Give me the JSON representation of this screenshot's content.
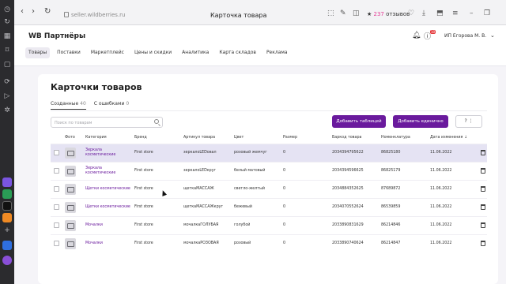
{
  "browser": {
    "url": "seller.wildberries.ru",
    "tab_title": "Карточка товара",
    "reviews_count": "237",
    "reviews_label": "отзывов"
  },
  "header": {
    "logo": "WB Партнёры",
    "notification_count": "10",
    "user_name": "ИП Егорова М. В."
  },
  "menu": [
    "Товары",
    "Поставки",
    "Маркетплейс",
    "Цены и скидки",
    "Аналитика",
    "Карта складов",
    "Реклама"
  ],
  "main": {
    "title": "Карточки товаров",
    "tabs": [
      {
        "label": "Созданные",
        "count": "40"
      },
      {
        "label": "С ошибками",
        "count": "0"
      }
    ],
    "search_placeholder": "Поиск по товарам",
    "btn_add_table": "Добавить таблицей",
    "btn_add_single": "Добавить единично"
  },
  "table": {
    "columns": [
      "",
      "Фото",
      "Категория",
      "Бренд",
      "Артикул товара",
      "Цвет",
      "Размер",
      "Баркод товара",
      "Номенклатура",
      "Дата изменения",
      ""
    ],
    "rows": [
      {
        "category": "Зеркала косметические",
        "brand": "First store",
        "article": "зеркалоLEDовал",
        "color": "розовый жемчуг",
        "size": "0",
        "barcode": "2034394795622",
        "nomenclature": "86825180",
        "date": "11.06.2022"
      },
      {
        "category": "Зеркала косметические",
        "brand": "First store",
        "article": "зеркалоLEDкруг",
        "color": "белый матовый",
        "size": "0",
        "barcode": "2034394596625",
        "nomenclature": "86825179",
        "date": "11.06.2022"
      },
      {
        "category": "Щетки косметические",
        "brand": "First store",
        "article": "щеткаМАССАЖ",
        "color": "светло-желтый",
        "size": "0",
        "barcode": "2034884352625",
        "nomenclature": "87689872",
        "date": "11.06.2022"
      },
      {
        "category": "Щетки косметические",
        "brand": "First store",
        "article": "щеткаМАССАЖкруг",
        "color": "бежевый",
        "size": "0",
        "barcode": "2034070552624",
        "nomenclature": "86539859",
        "date": "11.06.2022"
      },
      {
        "category": "Мочалки",
        "brand": "First store",
        "article": "мочалкаГОЛУБАЯ",
        "color": "голубой",
        "size": "0",
        "barcode": "2033890831629",
        "nomenclature": "86214846",
        "date": "11.06.2022"
      },
      {
        "category": "Мочалки",
        "brand": "First store",
        "article": "мочалкаРОЗОВАЯ",
        "color": "розовый",
        "size": "0",
        "barcode": "2033890740624",
        "nomenclature": "86214847",
        "date": "11.06.2022"
      }
    ]
  },
  "colors": {
    "accent": "#6a1a9d",
    "selected_row": "#e5e3f3",
    "badge": "#e5383b",
    "reviews": "#e53c96"
  }
}
